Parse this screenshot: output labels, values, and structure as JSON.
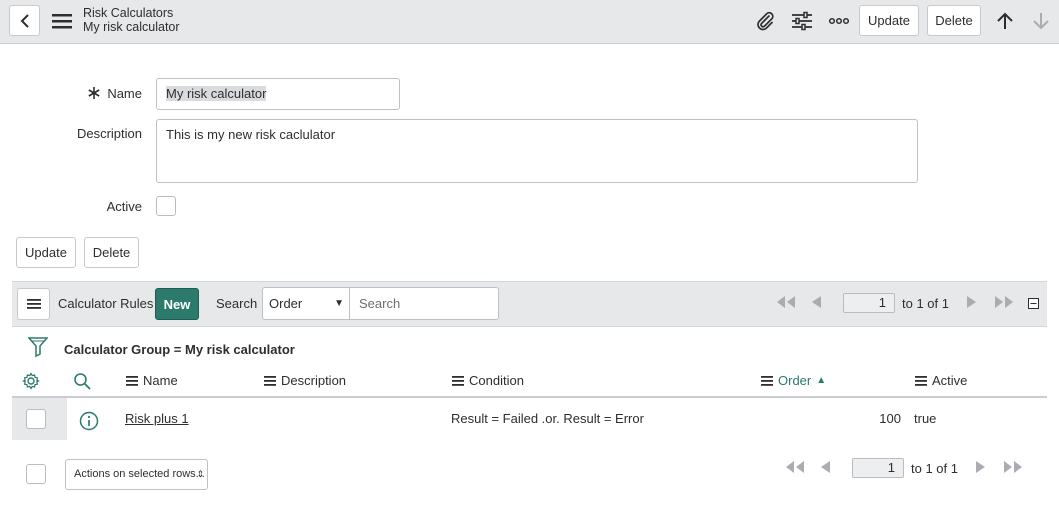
{
  "header": {
    "breadcrumb_parent": "Risk Calculators",
    "record_title": "My risk calculator",
    "update_label": "Update",
    "delete_label": "Delete"
  },
  "form": {
    "name_label": "Name",
    "name_value": "My risk calculator",
    "description_label": "Description",
    "description_value": "This is my new risk caclulator",
    "active_label": "Active",
    "update_label": "Update",
    "delete_label": "Delete"
  },
  "related_list": {
    "title": "Calculator Rules",
    "new_label": "New",
    "search_label": "Search",
    "search_field": "Order",
    "search_placeholder": "Search",
    "page_value": "1",
    "page_range": "to 1 of 1",
    "filter_breadcrumb": "Calculator Group = My risk calculator",
    "columns": [
      "Name",
      "Description",
      "Condition",
      "Order",
      "Active"
    ],
    "rows": [
      {
        "name": "Risk plus 1",
        "description": "",
        "condition": "Result = Failed .or. Result = Error",
        "order": "100",
        "active": "true"
      }
    ],
    "actions_placeholder": "Actions on selected rows...",
    "bottom_page_value": "1",
    "bottom_page_range": "to 1 of 1"
  },
  "colors": {
    "accent": "#2c7a6c",
    "header_bg": "#e6e8ea"
  }
}
